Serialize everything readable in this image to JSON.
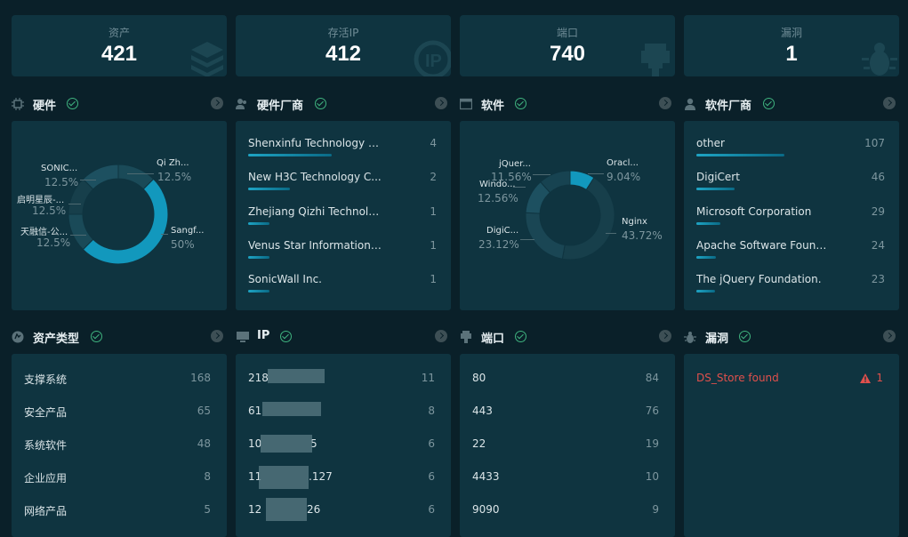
{
  "stats": [
    {
      "label": "资产",
      "value": "421"
    },
    {
      "label": "存活IP",
      "value": "412"
    },
    {
      "label": "端口",
      "value": "740"
    },
    {
      "label": "漏洞",
      "value": "1"
    }
  ],
  "sections": {
    "hardware": {
      "title": "硬件"
    },
    "hardware_vendor": {
      "title": "硬件厂商"
    },
    "software": {
      "title": "软件"
    },
    "software_vendor": {
      "title": "软件厂商"
    },
    "asset_type": {
      "title": "资产类型"
    },
    "ip": {
      "title": "IP"
    },
    "port": {
      "title": "端口"
    },
    "vuln": {
      "title": "漏洞"
    }
  },
  "hardware_chart": {
    "type": "pie",
    "labels": [
      "Qi Zh...",
      "Sangf...",
      "天融信-公...",
      "启明星辰-...",
      "SONIC..."
    ],
    "percents": [
      "12.5%",
      "50%",
      "12.5%",
      "12.5%",
      "12.5%"
    ],
    "values": [
      12.5,
      50,
      12.5,
      12.5,
      12.5
    ],
    "highlight_color": "#1298bd"
  },
  "software_chart": {
    "type": "pie",
    "labels": [
      "Oracl...",
      "Nginx",
      "DigiC...",
      "Windo...",
      "jQuer..."
    ],
    "percents": [
      "9.04%",
      "43.72%",
      "23.12%",
      "12.56%",
      "11.56%"
    ],
    "values": [
      9.04,
      43.72,
      23.12,
      12.56,
      11.56
    ],
    "highlight_color": "#1298bd"
  },
  "hardware_vendors": [
    {
      "name": "Shenxinfu Technology C...",
      "count": "4",
      "ratio": 1.0
    },
    {
      "name": "New H3C Technology C...",
      "count": "2",
      "ratio": 0.5
    },
    {
      "name": "Zhejiang Qizhi Technolo...",
      "count": "1",
      "ratio": 0.25
    },
    {
      "name": "Venus Star Information T...",
      "count": "1",
      "ratio": 0.25
    },
    {
      "name": "SonicWall Inc.",
      "count": "1",
      "ratio": 0.25
    }
  ],
  "software_vendors": [
    {
      "name": "other",
      "count": "107",
      "ratio": 1.0
    },
    {
      "name": "DigiCert",
      "count": "46",
      "ratio": 0.43
    },
    {
      "name": "Microsoft Corporation",
      "count": "29",
      "ratio": 0.27
    },
    {
      "name": "Apache Software Found...",
      "count": "24",
      "ratio": 0.22
    },
    {
      "name": "The jQuery Foundation.",
      "count": "23",
      "ratio": 0.21
    }
  ],
  "asset_types": [
    {
      "name": "支撑系统",
      "count": "168"
    },
    {
      "name": "安全产品",
      "count": "65"
    },
    {
      "name": "系统软件",
      "count": "48"
    },
    {
      "name": "企业应用",
      "count": "8"
    },
    {
      "name": "网络产品",
      "count": "5"
    }
  ],
  "ips": [
    {
      "name": "218",
      "count": "11"
    },
    {
      "name": "61",
      "count": "8"
    },
    {
      "name": "10",
      "tail": "5",
      "count": "6"
    },
    {
      "name": "11",
      "tail": ".127",
      "count": "6"
    },
    {
      "name": "12",
      "tail": "26",
      "count": "6"
    }
  ],
  "ports": [
    {
      "name": "80",
      "count": "84"
    },
    {
      "name": "443",
      "count": "76"
    },
    {
      "name": "22",
      "count": "19"
    },
    {
      "name": "4433",
      "count": "10"
    },
    {
      "name": "9090",
      "count": "9"
    }
  ],
  "vulns": [
    {
      "name": "DS_Store found",
      "count": "1",
      "color": "#e0504c"
    }
  ],
  "colors": {
    "bg": "#0a2029",
    "panel": "#0f3440",
    "accent": "#1298bd",
    "ok": "#3fb37f",
    "danger": "#e0504c"
  }
}
